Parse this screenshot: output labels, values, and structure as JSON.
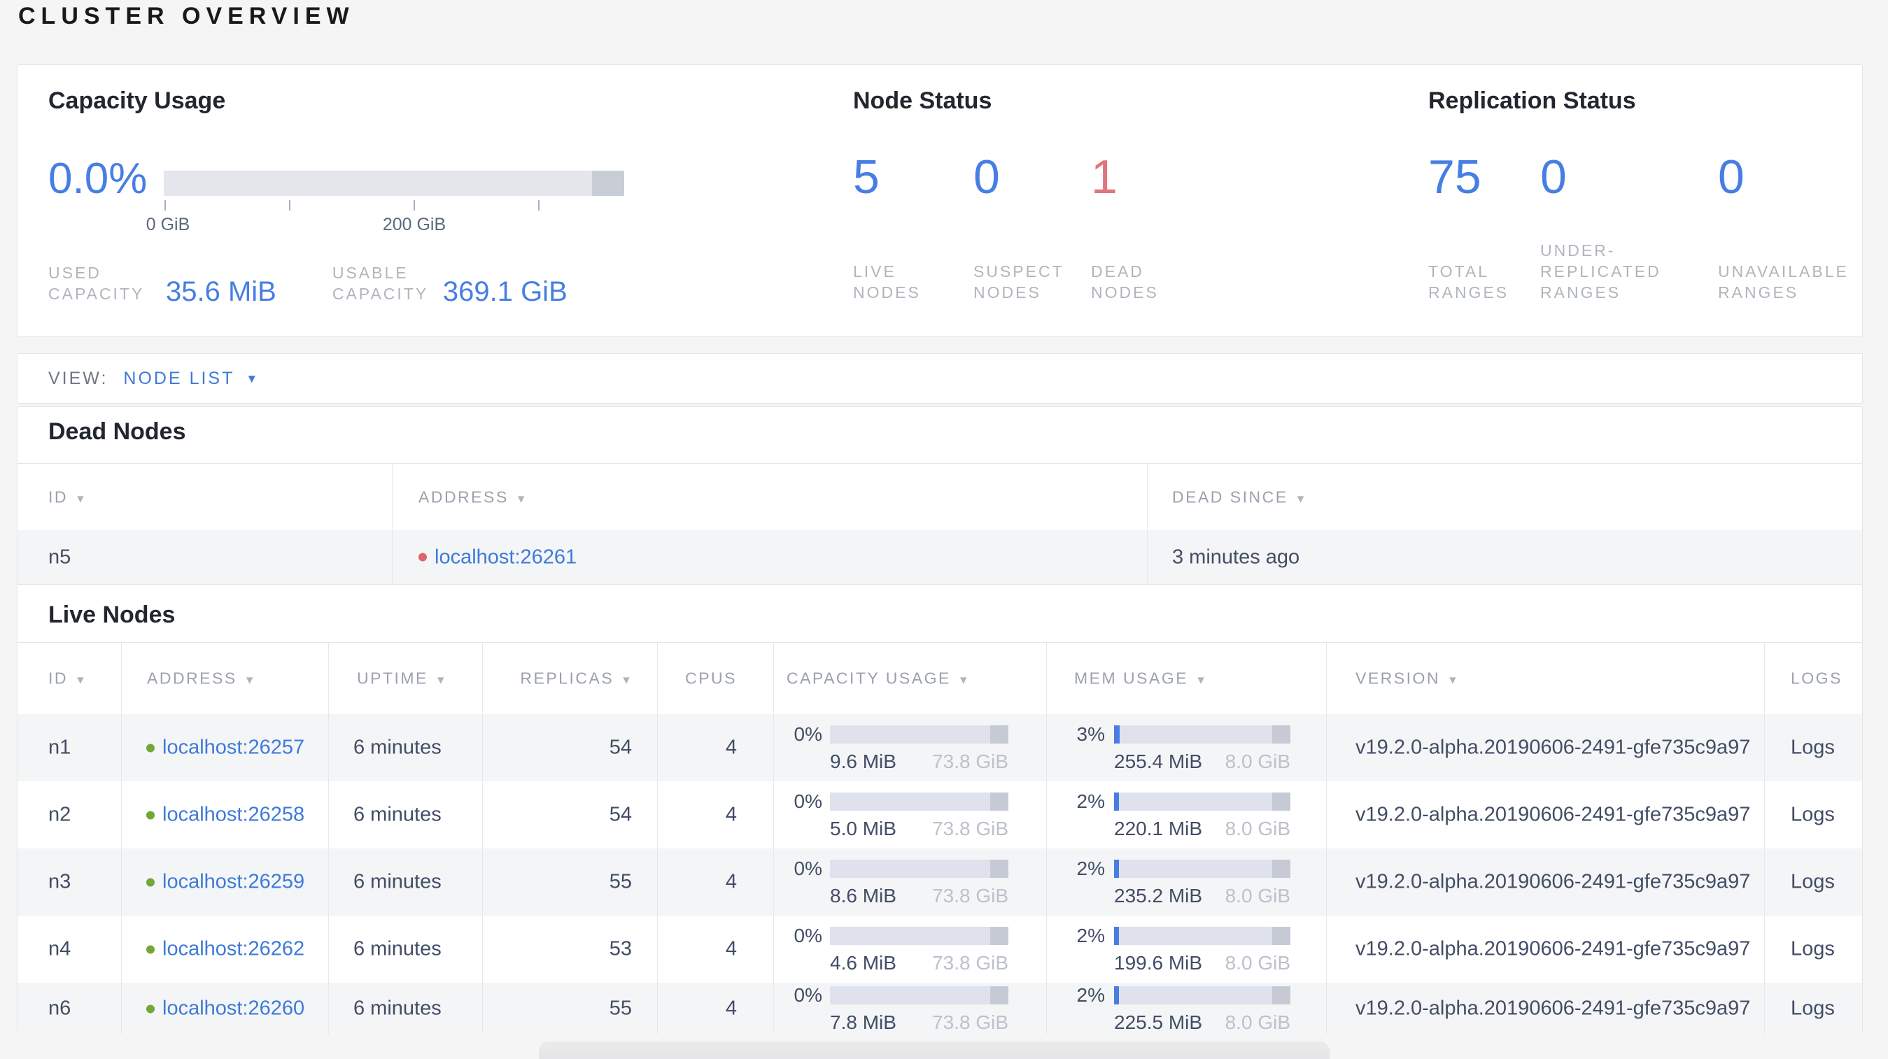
{
  "page_title": "CLUSTER OVERVIEW",
  "glyphs": {
    "sort_triangle": "▼",
    "dropdown_caret": "▼"
  },
  "colors": {
    "metric_blue": "#477ee3",
    "link_blue": "#3e7ad9",
    "danger_red": "#e0757c",
    "live_dot_green": "#73a737",
    "dead_dot_red": "#de646b"
  },
  "capacity_usage": {
    "title": "Capacity Usage",
    "percent": "0.0%",
    "axis_ticks": [
      "0 GiB",
      "200 GiB"
    ],
    "used_label": "USED CAPACITY",
    "used_value": "35.6 MiB",
    "usable_label": "USABLE CAPACITY",
    "usable_value": "369.1 GiB"
  },
  "node_status": {
    "title": "Node Status",
    "items": [
      {
        "value": "5",
        "label": "LIVE NODES",
        "color": "blue"
      },
      {
        "value": "0",
        "label": "SUSPECT NODES",
        "color": "blue"
      },
      {
        "value": "1",
        "label": "DEAD NODES",
        "color": "red"
      }
    ]
  },
  "replication_status": {
    "title": "Replication Status",
    "items": [
      {
        "value": "75",
        "label": "TOTAL RANGES",
        "color": "blue"
      },
      {
        "value": "0",
        "label": "UNDER-REPLICATED RANGES",
        "color": "blue"
      },
      {
        "value": "0",
        "label": "UNAVAILABLE RANGES",
        "color": "blue"
      }
    ]
  },
  "view_bar": {
    "label": "VIEW:",
    "selected": "NODE LIST"
  },
  "dead_nodes": {
    "heading": "Dead Nodes",
    "columns": [
      {
        "label": "ID",
        "sortable": true
      },
      {
        "label": "ADDRESS",
        "sortable": true
      },
      {
        "label": "DEAD SINCE",
        "sortable": true
      }
    ],
    "rows": [
      {
        "id": "n5",
        "address": "localhost:26261",
        "dead_since": "3 minutes ago"
      }
    ]
  },
  "live_nodes": {
    "heading": "Live Nodes",
    "logs_link_label": "Logs",
    "columns": [
      {
        "label": "ID",
        "sortable": true
      },
      {
        "label": "ADDRESS",
        "sortable": true
      },
      {
        "label": "UPTIME",
        "sortable": true
      },
      {
        "label": "REPLICAS",
        "sortable": true
      },
      {
        "label": "CPUS",
        "sortable": false
      },
      {
        "label": "CAPACITY USAGE",
        "sortable": true
      },
      {
        "label": "MEM USAGE",
        "sortable": true
      },
      {
        "label": "VERSION",
        "sortable": true
      },
      {
        "label": "LOGS",
        "sortable": false
      }
    ],
    "rows": [
      {
        "id": "n1",
        "address": "localhost:26257",
        "uptime": "6 minutes",
        "replicas": "54",
        "cpus": "4",
        "capacity_pct": "0%",
        "capacity_used": "9.6 MiB",
        "capacity_total": "73.8 GiB",
        "mem_pct": "3%",
        "mem_used": "255.4 MiB",
        "mem_total": "8.0 GiB",
        "version": "v19.2.0-alpha.20190606-2491-gfe735c9a97"
      },
      {
        "id": "n2",
        "address": "localhost:26258",
        "uptime": "6 minutes",
        "replicas": "54",
        "cpus": "4",
        "capacity_pct": "0%",
        "capacity_used": "5.0 MiB",
        "capacity_total": "73.8 GiB",
        "mem_pct": "2%",
        "mem_used": "220.1 MiB",
        "mem_total": "8.0 GiB",
        "version": "v19.2.0-alpha.20190606-2491-gfe735c9a97"
      },
      {
        "id": "n3",
        "address": "localhost:26259",
        "uptime": "6 minutes",
        "replicas": "55",
        "cpus": "4",
        "capacity_pct": "0%",
        "capacity_used": "8.6 MiB",
        "capacity_total": "73.8 GiB",
        "mem_pct": "2%",
        "mem_used": "235.2 MiB",
        "mem_total": "8.0 GiB",
        "version": "v19.2.0-alpha.20190606-2491-gfe735c9a97"
      },
      {
        "id": "n4",
        "address": "localhost:26262",
        "uptime": "6 minutes",
        "replicas": "53",
        "cpus": "4",
        "capacity_pct": "0%",
        "capacity_used": "4.6 MiB",
        "capacity_total": "73.8 GiB",
        "mem_pct": "2%",
        "mem_used": "199.6 MiB",
        "mem_total": "8.0 GiB",
        "version": "v19.2.0-alpha.20190606-2491-gfe735c9a97"
      },
      {
        "id": "n6",
        "address": "localhost:26260",
        "uptime": "6 minutes",
        "replicas": "55",
        "cpus": "4",
        "capacity_pct": "0%",
        "capacity_used": "7.8 MiB",
        "capacity_total": "73.8 GiB",
        "mem_pct": "2%",
        "mem_used": "225.5 MiB",
        "mem_total": "8.0 GiB",
        "version": "v19.2.0-alpha.20190606-2491-gfe735c9a97"
      }
    ]
  }
}
